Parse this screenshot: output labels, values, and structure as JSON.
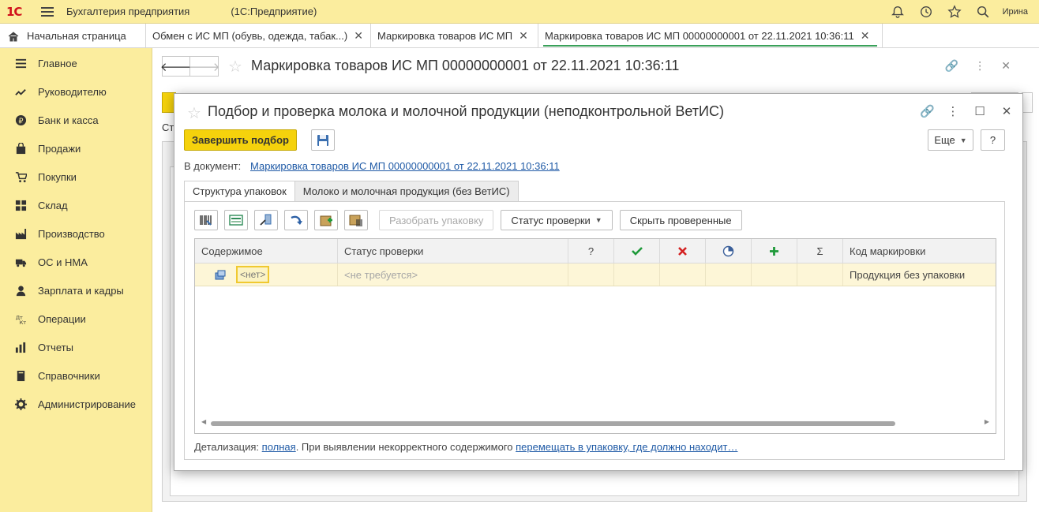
{
  "app": {
    "logo": "1С",
    "title": "Бухгалтерия предприятия",
    "subtitle": "(1С:Предприятие)",
    "user": "Ирина"
  },
  "tabs": [
    {
      "label": "Начальная страница"
    },
    {
      "label": "Обмен с ИС МП (обувь, одежда, табак...)"
    },
    {
      "label": "Маркировка товаров ИС МП"
    },
    {
      "label": "Маркировка товаров ИС МП 00000000001 от 22.11.2021 10:36:11"
    }
  ],
  "sidebar": {
    "items": [
      {
        "label": "Главное",
        "icon": "list-icon"
      },
      {
        "label": "Руководителю",
        "icon": "trend-icon"
      },
      {
        "label": "Банк и касса",
        "icon": "ruble-icon"
      },
      {
        "label": "Продажи",
        "icon": "shopping-bag-icon"
      },
      {
        "label": "Покупки",
        "icon": "cart-icon"
      },
      {
        "label": "Склад",
        "icon": "warehouse-icon"
      },
      {
        "label": "Производство",
        "icon": "factory-icon"
      },
      {
        "label": "ОС и НМА",
        "icon": "truck-icon"
      },
      {
        "label": "Зарплата и кадры",
        "icon": "person-icon"
      },
      {
        "label": "Операции",
        "icon": "dt-kt-icon"
      },
      {
        "label": "Отчеты",
        "icon": "bar-chart-icon"
      },
      {
        "label": "Справочники",
        "icon": "book-icon"
      },
      {
        "label": "Администрирование",
        "icon": "gear-icon"
      }
    ]
  },
  "background_doc": {
    "title": "Маркировка товаров ИС МП 00000000001 от 22.11.2021 10:36:11",
    "partial_text": "Ст"
  },
  "modal": {
    "title": "Подбор и проверка молока и молочной продукции (неподконтрольной ВетИС)",
    "finish_button": "Завершить подбор",
    "more_button": "Еще",
    "help_button": "?",
    "document_label": "В документ:",
    "document_link": "Маркировка товаров ИС МП 00000000001 от 22.11.2021 10:36:11",
    "tabs": [
      {
        "label": "Структура упаковок"
      },
      {
        "label": "Молоко и молочная продукция (без ВетИС)"
      }
    ],
    "toolbar": {
      "unpack_button": "Разобрать упаковку",
      "status_button": "Статус проверки",
      "hide_checked_button": "Скрыть проверенные"
    },
    "grid": {
      "columns": [
        "Содержимое",
        "Статус проверки",
        "?",
        "",
        "",
        "",
        "",
        "Σ",
        "Код маркировки"
      ],
      "rows": [
        {
          "content": "<нет>",
          "status": "<не требуется>",
          "code": "Продукция без упаковки"
        }
      ]
    },
    "footer": {
      "prefix": "Детализация:",
      "link1": "полная",
      "middle": ". При выявлении некорректного содержимого",
      "link2": "перемещать в упаковку, где должно находит…"
    }
  }
}
